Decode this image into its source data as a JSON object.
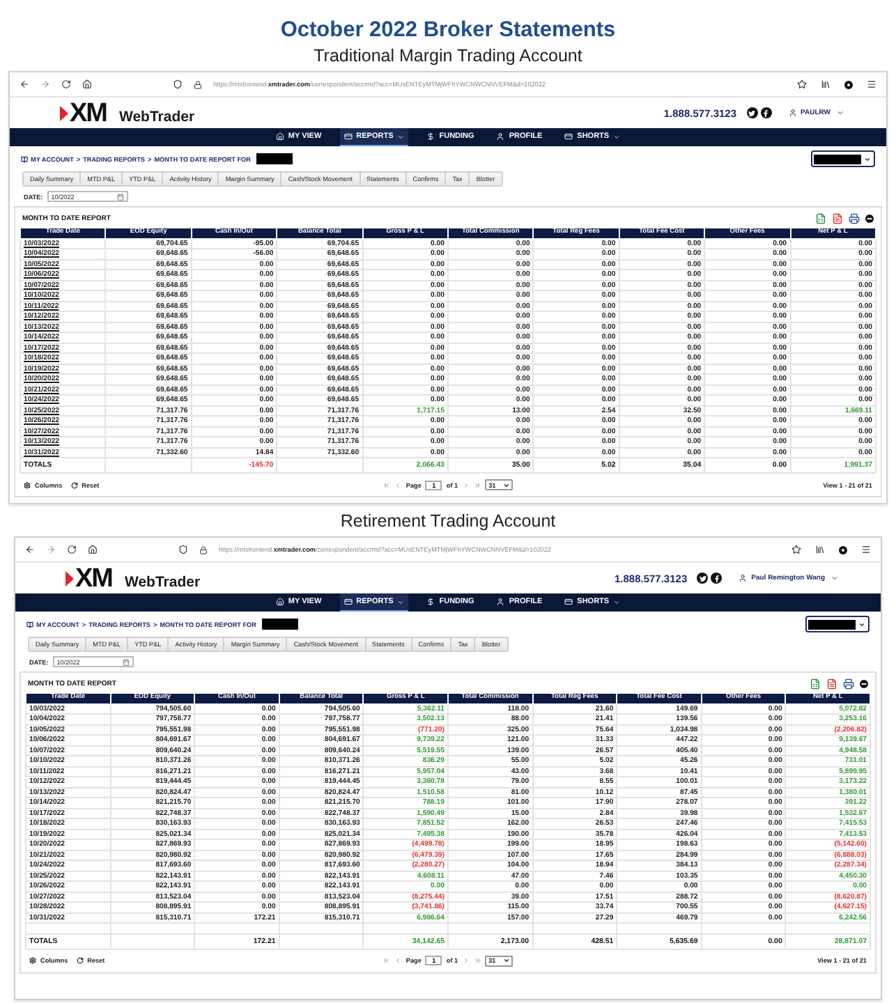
{
  "heading": {
    "title": "October 2022 Broker Statements"
  },
  "accounts": [
    {
      "caption": "Traditional Margin Trading Account",
      "browser": {
        "url": "https://mtsfrontend.**xmtrader.com**/correspondent/accmtd?acc=MUsENTEyMTMjWFhYWCNWCNNVEFM&d=102022"
      },
      "site": {
        "logo": "XM",
        "product": "WebTrader",
        "phone": "1.888.577.3123",
        "user": "PAULRW"
      },
      "nav": [
        {
          "label": "MY VIEW",
          "selected": false,
          "dropdown": false
        },
        {
          "label": "REPORTS",
          "selected": true,
          "dropdown": true
        },
        {
          "label": "FUNDING",
          "selected": false,
          "dropdown": false
        },
        {
          "label": "PROFILE",
          "selected": false,
          "dropdown": false
        },
        {
          "label": "SHORTS",
          "selected": false,
          "dropdown": true
        }
      ],
      "breadcrumb": {
        "items": [
          "MY ACCOUNT",
          "TRADING REPORTS",
          "MONTH TO DATE REPORT FOR"
        ],
        "separator": ">"
      },
      "tabs": [
        "Daily Summary",
        "MTD P&L",
        "YTD P&L",
        "Activity History",
        "Margin Summary",
        "Cash/Stock Movement",
        "Statements",
        "Confirms",
        "Tax",
        "Blotter"
      ],
      "date": {
        "label": "DATE:",
        "value": "10/2022"
      },
      "report": {
        "title": "MONTH TO DATE REPORT",
        "date_links": true,
        "spacer_row": false,
        "columns": [
          "Trade Date",
          "EOD Equity",
          "Cash In/Out",
          "Balance Total",
          "Gross P & L",
          "Total Commission",
          "Total Reg Fees",
          "Total Fee Cost",
          "Other Fees",
          "Net P & L"
        ],
        "rows": [
          [
            "10/03/2022",
            "69,704.65",
            "-95.00",
            "69,704.65",
            "0.00",
            "0.00",
            "0.00",
            "0.00",
            "0.00",
            "0.00"
          ],
          [
            "10/04/2022",
            "69,648.65",
            "-56.00",
            "69,648.65",
            "0.00",
            "0.00",
            "0.00",
            "0.00",
            "0.00",
            "0.00"
          ],
          [
            "10/05/2022",
            "69,648.65",
            "0.00",
            "69,648.65",
            "0.00",
            "0.00",
            "0.00",
            "0.00",
            "0.00",
            "0.00"
          ],
          [
            "10/06/2022",
            "69,648.65",
            "0.00",
            "69,648.65",
            "0.00",
            "0.00",
            "0.00",
            "0.00",
            "0.00",
            "0.00"
          ],
          [
            "10/07/2022",
            "69,648.65",
            "0.00",
            "69,648.65",
            "0.00",
            "0.00",
            "0.00",
            "0.00",
            "0.00",
            "0.00"
          ],
          [
            "10/10/2022",
            "69,648.65",
            "0.00",
            "69,648.65",
            "0.00",
            "0.00",
            "0.00",
            "0.00",
            "0.00",
            "0.00"
          ],
          [
            "10/11/2022",
            "69,648.65",
            "0.00",
            "69,648.65",
            "0.00",
            "0.00",
            "0.00",
            "0.00",
            "0.00",
            "0.00"
          ],
          [
            "10/12/2022",
            "69,648.65",
            "0.00",
            "69,648.65",
            "0.00",
            "0.00",
            "0.00",
            "0.00",
            "0.00",
            "0.00"
          ],
          [
            "10/13/2022",
            "69,648.65",
            "0.00",
            "69,648.65",
            "0.00",
            "0.00",
            "0.00",
            "0.00",
            "0.00",
            "0.00"
          ],
          [
            "10/14/2022",
            "69,648.65",
            "0.00",
            "69,648.65",
            "0.00",
            "0.00",
            "0.00",
            "0.00",
            "0.00",
            "0.00"
          ],
          [
            "10/17/2022",
            "69,648.65",
            "0.00",
            "69,648.65",
            "0.00",
            "0.00",
            "0.00",
            "0.00",
            "0.00",
            "0.00"
          ],
          [
            "10/18/2022",
            "69,648.65",
            "0.00",
            "69,648.65",
            "0.00",
            "0.00",
            "0.00",
            "0.00",
            "0.00",
            "0.00"
          ],
          [
            "10/19/2022",
            "69,648.65",
            "0.00",
            "69,648.65",
            "0.00",
            "0.00",
            "0.00",
            "0.00",
            "0.00",
            "0.00"
          ],
          [
            "10/20/2022",
            "69,648.65",
            "0.00",
            "69,648.65",
            "0.00",
            "0.00",
            "0.00",
            "0.00",
            "0.00",
            "0.00"
          ],
          [
            "10/21/2022",
            "69,648.65",
            "0.00",
            "69,648.65",
            "0.00",
            "0.00",
            "0.00",
            "0.00",
            "0.00",
            "0.00"
          ],
          [
            "10/24/2022",
            "69,648.65",
            "0.00",
            "69,648.65",
            "0.00",
            "0.00",
            "0.00",
            "0.00",
            "0.00",
            "0.00"
          ],
          [
            "10/25/2022",
            "71,317.76",
            "0.00",
            "71,317.76",
            {
              "text": "1,717.15",
              "color": "#2f9a2f"
            },
            "13.00",
            "2.54",
            "32.50",
            "0.00",
            {
              "text": "1,669.11",
              "color": "#2f9a2f"
            }
          ],
          [
            "10/26/2022",
            "71,317.76",
            "0.00",
            "71,317.76",
            "0.00",
            "0.00",
            "0.00",
            "0.00",
            "0.00",
            "0.00"
          ],
          [
            "10/27/2022",
            "71,317.76",
            "0.00",
            "71,317.76",
            "0.00",
            "0.00",
            "0.00",
            "0.00",
            "0.00",
            "0.00"
          ],
          [
            "10/13/2022",
            "71,317.76",
            "0.00",
            "71,317.76",
            "0.00",
            "0.00",
            "0.00",
            "0.00",
            "0.00",
            "0.00"
          ],
          [
            "10/31/2022",
            "71,332.60",
            "14.84",
            "71,332.60",
            "0.00",
            "0.00",
            "0.00",
            "0.00",
            "0.00",
            "0.00"
          ]
        ],
        "totals": {
          "label": "TOTALS",
          "cash_in_out": {
            "text": "-145.70",
            "color": "#e53030"
          },
          "gross_p_l": {
            "text": "2,066.43",
            "color": "#2f9a2f"
          },
          "total_commission": "35.00",
          "total_reg_fees": "5.02",
          "total_fee_cost": "35.04",
          "other_fees": "0.00",
          "net_p_l": {
            "text": "1,991.37",
            "color": "#2f9a2f"
          }
        }
      },
      "footer": {
        "columns": "Columns",
        "reset": "Reset",
        "page_label": "Page",
        "page": "1",
        "page_total": "of 1",
        "page_size": "31",
        "summary": "View 1 - 21 of 21"
      }
    },
    {
      "caption": "Retirement Trading Account",
      "browser": {
        "url": "https://mtsfrontend.**xmtrader.com**/correspondent/accmtd?acc=MUsENTEyMTMjWFhYWCNWCNNVEFM&d=102022"
      },
      "site": {
        "logo": "XM",
        "product": "WebTrader",
        "phone": "1.888.577.3123",
        "user": "Paul Remington Wang"
      },
      "nav": [
        {
          "label": "MY VIEW",
          "selected": false,
          "dropdown": false
        },
        {
          "label": "REPORTS",
          "selected": true,
          "dropdown": true
        },
        {
          "label": "FUNDING",
          "selected": false,
          "dropdown": false
        },
        {
          "label": "PROFILE",
          "selected": false,
          "dropdown": false
        },
        {
          "label": "SHORTS",
          "selected": false,
          "dropdown": true
        }
      ],
      "breadcrumb": {
        "items": [
          "MY ACCOUNT",
          "TRADING REPORTS",
          "MONTH TO DATE REPORT FOR"
        ],
        "separator": ">"
      },
      "tabs": [
        "Daily Summary",
        "MTD P&L",
        "YTD P&L",
        "Activity History",
        "Margin Summary",
        "Cash/Stock Movement",
        "Statements",
        "Confirms",
        "Tax",
        "Blotter"
      ],
      "date": {
        "label": "DATE:",
        "value": "10/2022"
      },
      "report": {
        "title": "MONTH TO DATE REPORT",
        "date_links": false,
        "spacer_row": true,
        "columns": [
          "Trade Date",
          "EOD Equity",
          "Cash In/Out",
          "Balance Total",
          "Gross P & L",
          "Total Commission",
          "Total Reg Fees",
          "Total Fee Cost",
          "Other Fees",
          "Net P & L"
        ],
        "rows": [
          [
            "10/03/2022",
            "794,505.60",
            "0.00",
            "794,505.60",
            {
              "text": "5,362.11",
              "color": "#2f9a2f"
            },
            "118.00",
            "21.60",
            "149.69",
            "0.00",
            {
              "text": "5,072.82",
              "color": "#2f9a2f"
            }
          ],
          [
            "10/04/2022",
            "797,758.77",
            "0.00",
            "797,758.77",
            {
              "text": "3,502.13",
              "color": "#2f9a2f"
            },
            "88.00",
            "21.41",
            "139.56",
            "0.00",
            {
              "text": "3,253.16",
              "color": "#2f9a2f"
            }
          ],
          [
            "10/05/2022",
            "795,551.98",
            "0.00",
            "795,551.98",
            {
              "text": "(771.20)",
              "color": "#e53030"
            },
            "325.00",
            "75.64",
            "1,034.98",
            "0.00",
            {
              "text": "(2,206.82)",
              "color": "#e53030"
            }
          ],
          [
            "10/06/2022",
            "804,691.67",
            "0.00",
            "804,691.67",
            {
              "text": "9,739.22",
              "color": "#2f9a2f"
            },
            "121.00",
            "31.33",
            "447.22",
            "0.00",
            {
              "text": "9,139.67",
              "color": "#2f9a2f"
            }
          ],
          [
            "10/07/2022",
            "809,640.24",
            "0.00",
            "809,640.24",
            {
              "text": "5,519.55",
              "color": "#2f9a2f"
            },
            "139.00",
            "26.57",
            "405.40",
            "0.00",
            {
              "text": "4,948.58",
              "color": "#2f9a2f"
            }
          ],
          [
            "10/10/2022",
            "810,371.26",
            "0.00",
            "810,371.26",
            {
              "text": "836.29",
              "color": "#2f9a2f"
            },
            "55.00",
            "5.02",
            "45.26",
            "0.00",
            {
              "text": "731.01",
              "color": "#2f9a2f"
            }
          ],
          [
            "10/11/2022",
            "816,271.21",
            "0.00",
            "816,271.21",
            {
              "text": "5,957.04",
              "color": "#2f9a2f"
            },
            "43.00",
            "3.68",
            "10.41",
            "0.00",
            {
              "text": "5,899.95",
              "color": "#2f9a2f"
            }
          ],
          [
            "10/12/2022",
            "819,444.45",
            "0.00",
            "819,444.45",
            {
              "text": "3,360.78",
              "color": "#2f9a2f"
            },
            "79.00",
            "8.55",
            "100.01",
            "0.00",
            {
              "text": "3,173.22",
              "color": "#2f9a2f"
            }
          ],
          [
            "10/13/2022",
            "820,824.47",
            "0.00",
            "820,824.47",
            {
              "text": "1,510.58",
              "color": "#2f9a2f"
            },
            "81.00",
            "10.12",
            "87.45",
            "0.00",
            {
              "text": "1,380.01",
              "color": "#2f9a2f"
            }
          ],
          [
            "10/14/2022",
            "821,215.70",
            "0.00",
            "821,215.70",
            {
              "text": "788.19",
              "color": "#2f9a2f"
            },
            "101.00",
            "17.90",
            "278.07",
            "0.00",
            {
              "text": "391.22",
              "color": "#2f9a2f"
            }
          ],
          [
            "10/17/2022",
            "822,748.37",
            "0.00",
            "822,748.37",
            {
              "text": "1,590.49",
              "color": "#2f9a2f"
            },
            "15.00",
            "2.84",
            "39.98",
            "0.00",
            {
              "text": "1,532.67",
              "color": "#2f9a2f"
            }
          ],
          [
            "10/18/2022",
            "830,163.93",
            "0.00",
            "830,163.93",
            {
              "text": "7,851.52",
              "color": "#2f9a2f"
            },
            "162.00",
            "26.53",
            "247.46",
            "0.00",
            {
              "text": "7,415.53",
              "color": "#2f9a2f"
            }
          ],
          [
            "10/19/2022",
            "825,021.34",
            "0.00",
            "825,021.34",
            {
              "text": "7,495.38",
              "color": "#2f9a2f"
            },
            "190.00",
            "35.78",
            "426.04",
            "0.00",
            {
              "text": "7,413.53",
              "color": "#2f9a2f"
            }
          ],
          [
            "10/20/2022",
            "827,869.93",
            "0.00",
            "827,869.93",
            {
              "text": "(4,499.78)",
              "color": "#e53030"
            },
            "199.00",
            "18.95",
            "198.63",
            "0.00",
            {
              "text": "(5,142.60)",
              "color": "#e53030"
            }
          ],
          [
            "10/21/2022",
            "820,980.92",
            "0.00",
            "820,980.92",
            {
              "text": "(6,479.39)",
              "color": "#e53030"
            },
            "107.00",
            "17.65",
            "284.99",
            "0.00",
            {
              "text": "(6,888.03)",
              "color": "#e53030"
            }
          ],
          [
            "10/24/2022",
            "817,693.60",
            "0.00",
            "817,693.60",
            {
              "text": "(2,280.27)",
              "color": "#e53030"
            },
            "104.00",
            "18.94",
            "384.13",
            "0.00",
            {
              "text": "(2,287.34)",
              "color": "#e53030"
            }
          ],
          [
            "10/25/2022",
            "822,143.91",
            "0.00",
            "822,143.91",
            {
              "text": "4,608.11",
              "color": "#2f9a2f"
            },
            "47.00",
            "7.46",
            "103.35",
            "0.00",
            {
              "text": "4,450.30",
              "color": "#2f9a2f"
            }
          ],
          [
            "10/26/2022",
            "822,143.91",
            "0.00",
            "822,143.91",
            {
              "text": "0.00",
              "color": "#2f9a2f"
            },
            "0.00",
            "0.00",
            "0.00",
            "0.00",
            {
              "text": "0.00",
              "color": "#2f9a2f"
            }
          ],
          [
            "10/27/2022",
            "813,523.04",
            "0.00",
            "813,523.04",
            {
              "text": "(8,275.44)",
              "color": "#e53030"
            },
            "39.00",
            "17.51",
            "288.72",
            "0.00",
            {
              "text": "(8,620.87)",
              "color": "#e53030"
            }
          ],
          [
            "10/28/2022",
            "808,895.91",
            "0.00",
            "808,895.91",
            {
              "text": "(3,741.86)",
              "color": "#e53030"
            },
            "115.00",
            "33.74",
            "700.55",
            "0.00",
            {
              "text": "(4,627.15)",
              "color": "#e53030"
            }
          ],
          [
            "10/31/2022",
            "815,310.71",
            "172.21",
            "815,310.71",
            {
              "text": "6,986.64",
              "color": "#2f9a2f"
            },
            "157.00",
            "27.29",
            "469.79",
            "0.00",
            {
              "text": "6,242.56",
              "color": "#2f9a2f"
            }
          ]
        ],
        "totals": {
          "label": "TOTALS",
          "cash_in_out": "172.21",
          "gross_p_l": {
            "text": "34,142.65",
            "color": "#2f9a2f"
          },
          "total_commission": "2,173.00",
          "total_reg_fees": "428.51",
          "total_fee_cost": "5,635.69",
          "other_fees": "0.00",
          "net_p_l": {
            "text": "28,871.07",
            "color": "#2f9a2f"
          }
        }
      },
      "footer": {
        "columns": "Columns",
        "reset": "Reset",
        "page_label": "Page",
        "page": "1",
        "page_total": "of 1",
        "page_size": "31",
        "summary": "View 1 - 21 of 21"
      }
    }
  ]
}
